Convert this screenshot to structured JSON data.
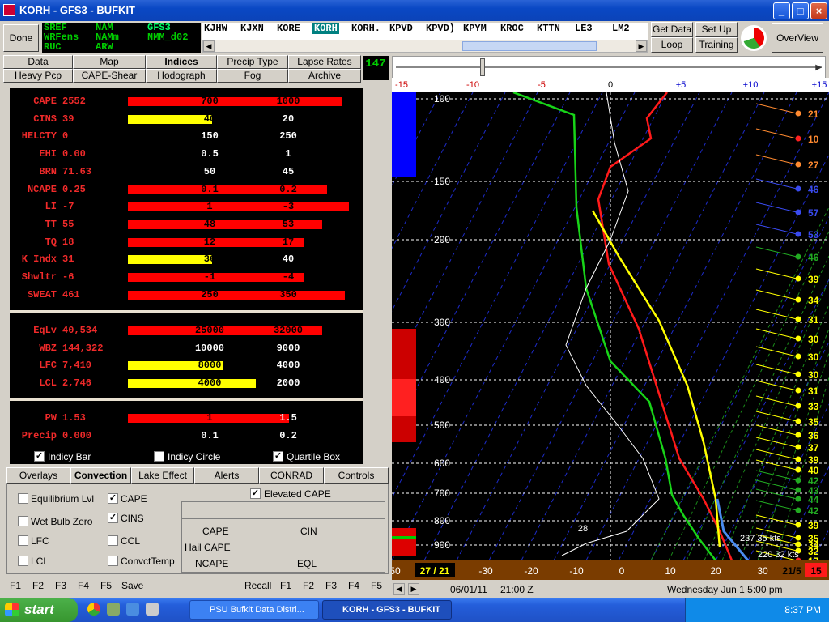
{
  "window": {
    "title": "KORH - GFS3 - BUFKIT"
  },
  "done_label": "Done",
  "models": [
    {
      "name": "SREF",
      "color": "#00cc00"
    },
    {
      "name": "NAM",
      "color": "#00cc00"
    },
    {
      "name": "GFS3",
      "color": "#00cc00",
      "selected": true
    },
    {
      "name": "WRFens",
      "color": "#00cc00"
    },
    {
      "name": "NAMm",
      "color": "#00cc00"
    },
    {
      "name": "NMM_d02",
      "color": "#00cc00"
    },
    {
      "name": "RUC",
      "color": "#00cc00"
    },
    {
      "name": "ARW",
      "color": "#00cc00"
    }
  ],
  "stations": [
    "KJHW",
    "KJXN",
    "KORE",
    "KORH",
    "KORH.",
    "KPVD",
    "KPVD)",
    "KPYM",
    "KROC",
    "KTTN",
    "LE3",
    "LM2"
  ],
  "selected_station": "KORH",
  "right_buttons": {
    "get_data": "Get Data",
    "loop": "Loop",
    "setup": "Set Up",
    "training": "Training",
    "overview": "OverView"
  },
  "nav_tabs_row1": [
    "Data",
    "Map",
    "Indices",
    "Precip Type",
    "Lapse Rates"
  ],
  "nav_tabs_row2": [
    "Heavy Pcp",
    "CAPE-Shear",
    "Hodograph",
    "Fog",
    "Archive"
  ],
  "selected_nav": "Indices",
  "frame_counter": "147",
  "indices": [
    {
      "label": "CAPE",
      "value": "2552",
      "bar_frac": 0.97,
      "bar_color": "#ff0000",
      "t1": "700",
      "t2": "1000"
    },
    {
      "label": "CINS",
      "value": "39",
      "bar_frac": 0.38,
      "bar_color": "#ffff00",
      "t1": "40",
      "t2": "20"
    },
    {
      "label": "HELCTY",
      "value": "0",
      "bar_frac": 0,
      "bar_color": "#ff0000",
      "t1": "150",
      "t2": "250"
    },
    {
      "label": "EHI",
      "value": "0.00",
      "bar_frac": 0,
      "bar_color": "#ff0000",
      "t1": "0.5",
      "t2": "1"
    },
    {
      "label": "BRN",
      "value": "71.63",
      "bar_frac": 0,
      "bar_color": "#ff0000",
      "t1": "50",
      "t2": "45"
    },
    {
      "label": "NCAPE",
      "value": "0.25",
      "bar_frac": 0.9,
      "bar_color": "#ff0000",
      "t1": "0.1",
      "t2": "0.2"
    },
    {
      "label": "LI",
      "value": "-7",
      "bar_frac": 1.0,
      "bar_color": "#ff0000",
      "t1": "1",
      "t2": "-3"
    },
    {
      "label": "TT",
      "value": "55",
      "bar_frac": 0.88,
      "bar_color": "#ff0000",
      "t1": "48",
      "t2": "53"
    },
    {
      "label": "TQ",
      "value": "18",
      "bar_frac": 0.8,
      "bar_color": "#ff0000",
      "t1": "12",
      "t2": "17"
    },
    {
      "label": "K Indx",
      "value": "31",
      "bar_frac": 0.38,
      "bar_color": "#ffff00",
      "t1": "36",
      "t2": "40"
    },
    {
      "label": "Shwltr",
      "value": "-6",
      "bar_frac": 0.8,
      "bar_color": "#ff0000",
      "t1": "-1",
      "t2": "-4"
    },
    {
      "label": "SWEAT",
      "value": "461",
      "bar_frac": 0.98,
      "bar_color": "#ff0000",
      "t1": "250",
      "t2": "350"
    }
  ],
  "indices2": [
    {
      "label": "EqLv",
      "value": "40,534",
      "bar_frac": 0.88,
      "bar_color": "#ff0000",
      "t1": "25000",
      "t2": "32000"
    },
    {
      "label": "WBZ",
      "value": "144,322",
      "bar_frac": 0,
      "bar_color": "#ff0000",
      "t1": "10000",
      "t2": "9000"
    },
    {
      "label": "LFC",
      "value": "7,410",
      "bar_frac": 0.43,
      "bar_color": "#ffff00",
      "t1": "8000",
      "t2": "4000"
    },
    {
      "label": "LCL",
      "value": "2,746",
      "bar_frac": 0.58,
      "bar_color": "#ffff00",
      "t1": "4000",
      "t2": "2000"
    }
  ],
  "indices3": [
    {
      "label": "PW",
      "value": "1.53",
      "bar_frac": 0.73,
      "bar_color": "#ff0000",
      "t1": "1",
      "t2": "1.5"
    },
    {
      "label": "Precip",
      "value": "0.000",
      "bar_frac": 0,
      "bar_color": "#ff0000",
      "t1": "0.1",
      "t2": "0.2"
    }
  ],
  "display_opts": [
    {
      "label": "Indicy Bar",
      "checked": true
    },
    {
      "label": "Indicy Circle",
      "checked": false
    },
    {
      "label": "Quartile Box",
      "checked": true
    }
  ],
  "bottom_tabs": [
    "Overlays",
    "Convection",
    "Lake Effect",
    "Alerts",
    "CONRAD",
    "Controls"
  ],
  "selected_bottom_tab": "Convection",
  "convection_opts": [
    {
      "label": "Equilibrium Lvl",
      "checked": false
    },
    {
      "label": "Wet Bulb Zero",
      "checked": false
    },
    {
      "label": "LFC",
      "checked": false
    },
    {
      "label": "LCL",
      "checked": false
    },
    {
      "label": "CAPE",
      "checked": true
    },
    {
      "label": "CINS",
      "checked": true
    },
    {
      "label": "CCL",
      "checked": false
    },
    {
      "label": "ConvctTemp",
      "checked": false
    }
  ],
  "elevated_cape": {
    "label": "Elevated CAPE",
    "checked": true
  },
  "cape_box": {
    "cape": "CAPE",
    "cin": "CIN",
    "hail": "Hail CAPE",
    "ncape": "NCAPE",
    "eql": "EQL"
  },
  "fkeys_left": [
    "F1",
    "F2",
    "F3",
    "F4",
    "F5"
  ],
  "save_label": "Save",
  "recall_label": "Recall",
  "fkeys_right": [
    "F1",
    "F2",
    "F3",
    "F4",
    "F5"
  ],
  "skewt": {
    "top_axis": [
      "-15",
      "-10",
      "-5",
      "0",
      "+5",
      "+10",
      "+15"
    ],
    "pressure_levels": [
      "100",
      "150",
      "200",
      "300",
      "400",
      "500",
      "600",
      "700",
      "800",
      "900"
    ],
    "temp_axis": [
      "50",
      "27 / 21",
      "-30",
      "-20",
      "-10",
      "0",
      "10",
      "20",
      "30",
      "21/5",
      "15"
    ],
    "wind_speeds": [
      "21",
      "10",
      "27",
      "46",
      "57",
      "53",
      "46",
      "39",
      "34",
      "31",
      "30",
      "30",
      "30",
      "31",
      "33",
      "35",
      "36",
      "37",
      "39",
      "40",
      "42",
      "43",
      "44",
      "42",
      "39",
      "35",
      "34",
      "32",
      "17"
    ],
    "label_28": "28",
    "storm1": "237 35 kts",
    "storm2": "220 32 kts"
  },
  "status": {
    "date": "06/01/11",
    "time": "21:00 Z",
    "local": "Wednesday  Jun 1  5:00 pm"
  },
  "taskbar": {
    "start": "start",
    "item1": "PSU Bufkit Data Distri...",
    "item2": "KORH - GFS3 - BUFKIT",
    "clock": "8:37 PM"
  }
}
